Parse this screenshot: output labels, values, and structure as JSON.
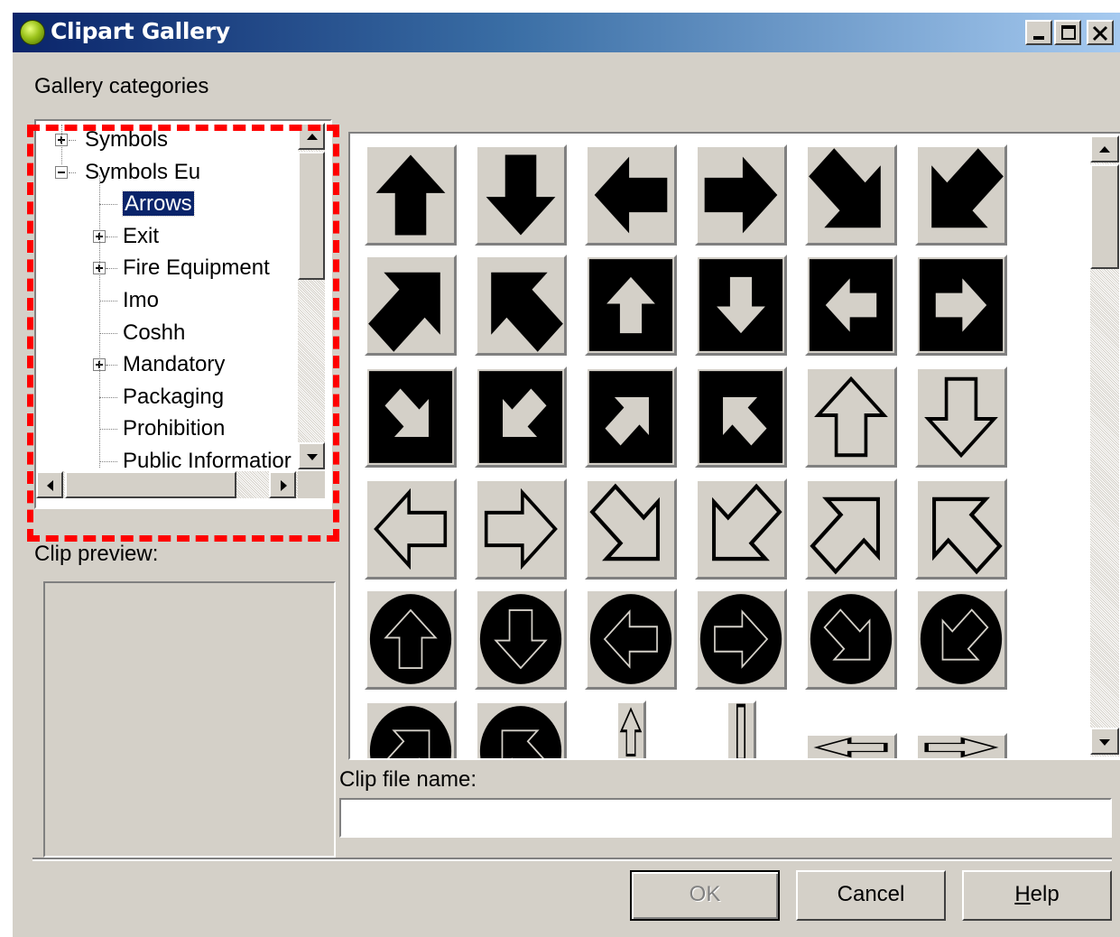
{
  "window": {
    "title": "Clipart Gallery",
    "controls": [
      "minimize-icon",
      "maximize-icon",
      "close-icon"
    ]
  },
  "labels": {
    "categories": "Gallery categories",
    "preview": "Clip preview:",
    "filename": "Clip file name:"
  },
  "tree": {
    "items": [
      {
        "label": "Symbols",
        "level": 0,
        "expander": "plus"
      },
      {
        "label": "Symbols Eu",
        "level": 0,
        "expander": "minus"
      },
      {
        "label": "Arrows",
        "level": 1,
        "expander": "none",
        "selected": true
      },
      {
        "label": "Exit",
        "level": 1,
        "expander": "plus"
      },
      {
        "label": "Fire Equipment",
        "level": 1,
        "expander": "plus"
      },
      {
        "label": "Imo",
        "level": 1,
        "expander": "none"
      },
      {
        "label": "Coshh",
        "level": 1,
        "expander": "none"
      },
      {
        "label": "Mandatory",
        "level": 1,
        "expander": "plus"
      },
      {
        "label": "Packaging",
        "level": 1,
        "expander": "none"
      },
      {
        "label": "Prohibition",
        "level": 1,
        "expander": "none"
      },
      {
        "label": "Public Informatior",
        "level": 1,
        "expander": "none"
      }
    ]
  },
  "filename_input": {
    "value": ""
  },
  "buttons": {
    "ok": "OK",
    "cancel": "Cancel",
    "help_mnemonic": "H",
    "help_rest": "elp"
  },
  "clips": [
    {
      "style": "solid",
      "dir": "up"
    },
    {
      "style": "solid",
      "dir": "down"
    },
    {
      "style": "solid",
      "dir": "left"
    },
    {
      "style": "solid",
      "dir": "right"
    },
    {
      "style": "solid",
      "dir": "down-right"
    },
    {
      "style": "solid",
      "dir": "down-left"
    },
    {
      "style": "solid",
      "dir": "up-right"
    },
    {
      "style": "solid",
      "dir": "up-left"
    },
    {
      "style": "boxed",
      "dir": "up"
    },
    {
      "style": "boxed",
      "dir": "down"
    },
    {
      "style": "boxed",
      "dir": "left"
    },
    {
      "style": "boxed",
      "dir": "right"
    },
    {
      "style": "boxed",
      "dir": "down-right"
    },
    {
      "style": "boxed",
      "dir": "down-left"
    },
    {
      "style": "boxed",
      "dir": "up-right"
    },
    {
      "style": "boxed",
      "dir": "up-left"
    },
    {
      "style": "outline",
      "dir": "up"
    },
    {
      "style": "outline",
      "dir": "down"
    },
    {
      "style": "outline",
      "dir": "left"
    },
    {
      "style": "outline",
      "dir": "right"
    },
    {
      "style": "outline",
      "dir": "down-right"
    },
    {
      "style": "outline",
      "dir": "down-left"
    },
    {
      "style": "outline",
      "dir": "up-right"
    },
    {
      "style": "outline",
      "dir": "up-left"
    },
    {
      "style": "circle",
      "dir": "up"
    },
    {
      "style": "circle",
      "dir": "down"
    },
    {
      "style": "circle",
      "dir": "left"
    },
    {
      "style": "circle",
      "dir": "right"
    },
    {
      "style": "circle",
      "dir": "down-right"
    },
    {
      "style": "circle",
      "dir": "down-left"
    },
    {
      "style": "circle",
      "dir": "up-right"
    },
    {
      "style": "circle",
      "dir": "up-left"
    },
    {
      "style": "thin",
      "dir": "up"
    },
    {
      "style": "thin",
      "dir": "bar"
    },
    {
      "style": "thin",
      "dir": "left"
    },
    {
      "style": "thin",
      "dir": "right"
    }
  ]
}
